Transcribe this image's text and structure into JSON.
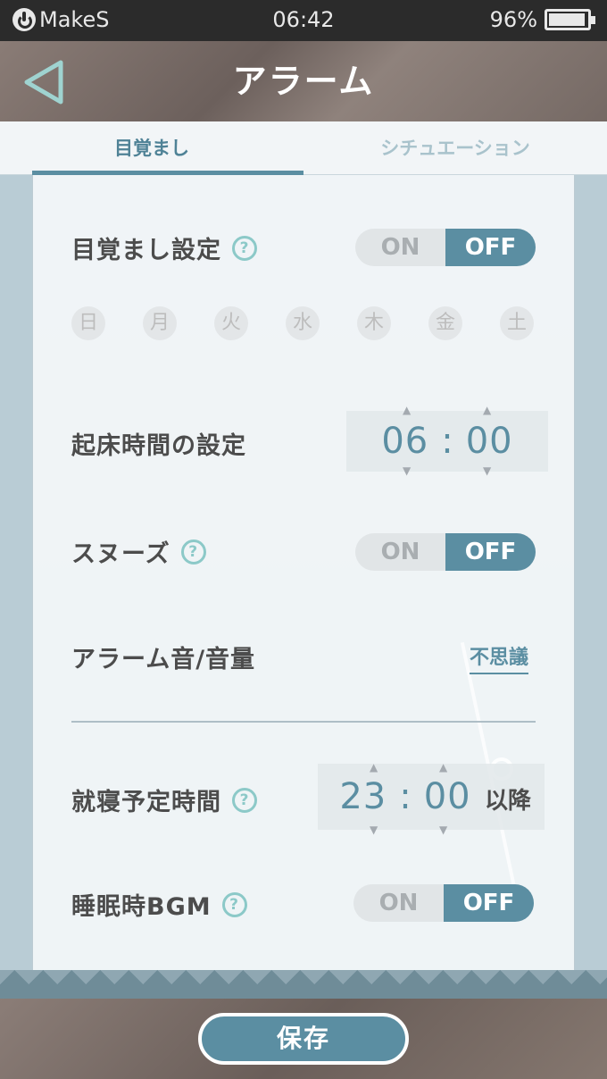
{
  "statusbar": {
    "carrier": "MakeS",
    "time": "06:42",
    "battery": "96%",
    "battery_level": 0.96
  },
  "header": {
    "title": "アラーム",
    "back_icon": "back-arrow-icon"
  },
  "tabs": [
    {
      "label": "目覚まし",
      "active": true
    },
    {
      "label": "シチュエーション",
      "active": false
    }
  ],
  "wake": {
    "label": "目覚まし設定",
    "on": "ON",
    "off": "OFF",
    "state": "OFF"
  },
  "days": [
    "日",
    "月",
    "火",
    "水",
    "木",
    "金",
    "土"
  ],
  "wake_time": {
    "label": "起床時間の設定",
    "hour": "06",
    "sep": ":",
    "minute": "00"
  },
  "snooze": {
    "label": "スヌーズ",
    "on": "ON",
    "off": "OFF",
    "state": "OFF"
  },
  "sound": {
    "label": "アラーム音/音量",
    "value": "不思議"
  },
  "bedtime": {
    "label": "就寝予定時間",
    "hour": "23",
    "sep": ":",
    "minute": "00",
    "suffix": "以降"
  },
  "bgm": {
    "label": "睡眠時BGM",
    "on": "ON",
    "off": "OFF",
    "state": "OFF"
  },
  "footer": {
    "save": "保存"
  },
  "colors": {
    "accent": "#5b8ea2",
    "help": "#8cc9c8",
    "header": "#7d6f6a"
  }
}
